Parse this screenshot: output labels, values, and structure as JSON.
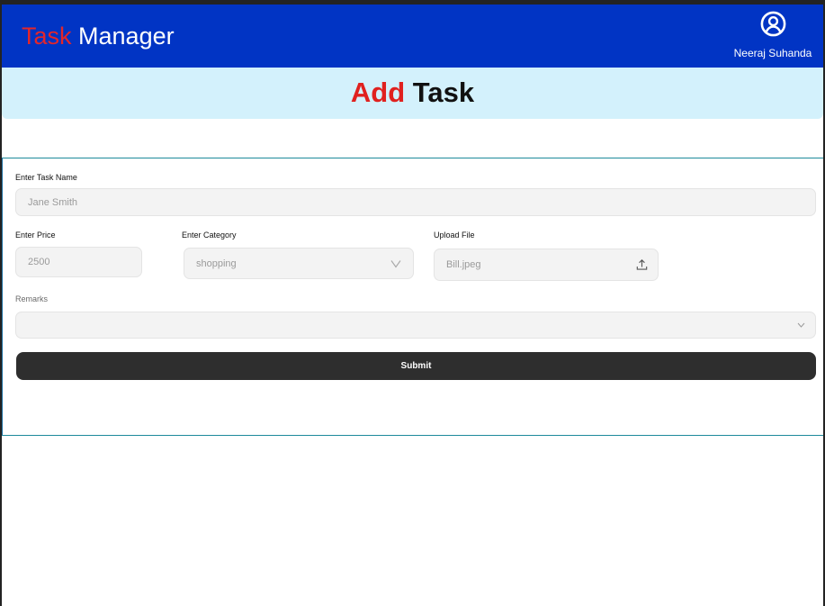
{
  "header": {
    "title_part1": "Task",
    "title_part2": " Manager",
    "user_name": "Neeraj Suhanda",
    "user_icon": "user-circle-icon"
  },
  "page": {
    "title_part1": "Add",
    "title_part2": " Task"
  },
  "form": {
    "task_name": {
      "label": "Enter Task Name",
      "value": "Jane Smith"
    },
    "price": {
      "label": "Enter Price",
      "value": "2500"
    },
    "category": {
      "label": "Enter Category",
      "value": "shopping",
      "icon": "chevron-down-icon"
    },
    "upload": {
      "label": "Upload File",
      "value": "Bill.jpeg",
      "icon": "upload-icon"
    },
    "remarks": {
      "label": "Remarks",
      "value": "",
      "icon": "chevron-down-icon"
    },
    "submit_label": "Submit"
  },
  "colors": {
    "header_bg": "#0134c4",
    "accent_red": "#e4262a",
    "banner_bg": "#d3f1fc",
    "button_bg": "#2e2e2e",
    "card_border": "#1d8a9b"
  }
}
